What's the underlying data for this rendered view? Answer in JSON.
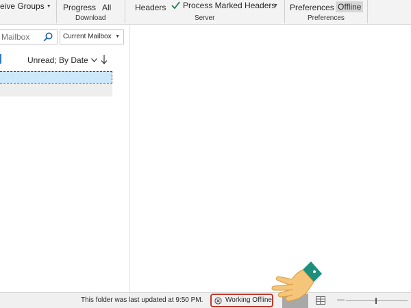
{
  "ribbon": {
    "groups": [
      {
        "name": "send-receive",
        "buttons": [
          "eive Groups"
        ],
        "label": ""
      },
      {
        "name": "download",
        "buttons": [
          "Progress",
          "All"
        ],
        "label": "Download"
      },
      {
        "name": "server",
        "buttons": [
          "Headers",
          "Process Marked Headers"
        ],
        "label": "Server"
      },
      {
        "name": "preferences",
        "buttons": [
          "Preferences",
          "Offline"
        ],
        "label": "Preferences"
      }
    ]
  },
  "listpane": {
    "search_placeholder": "Mailbox",
    "scope": "Current Mailbox",
    "sort_label": "Unread; By Date"
  },
  "statusbar": {
    "last_updated": "This folder was last updated at 9:50 PM.",
    "offline_status": "Working Offline"
  },
  "colors": {
    "accent": "#2b78c8",
    "selection": "#cde8fb",
    "offline_outline": "#c0392b",
    "hand_skin": "#f5c57a",
    "hand_cuff": "#1f8f7d"
  }
}
